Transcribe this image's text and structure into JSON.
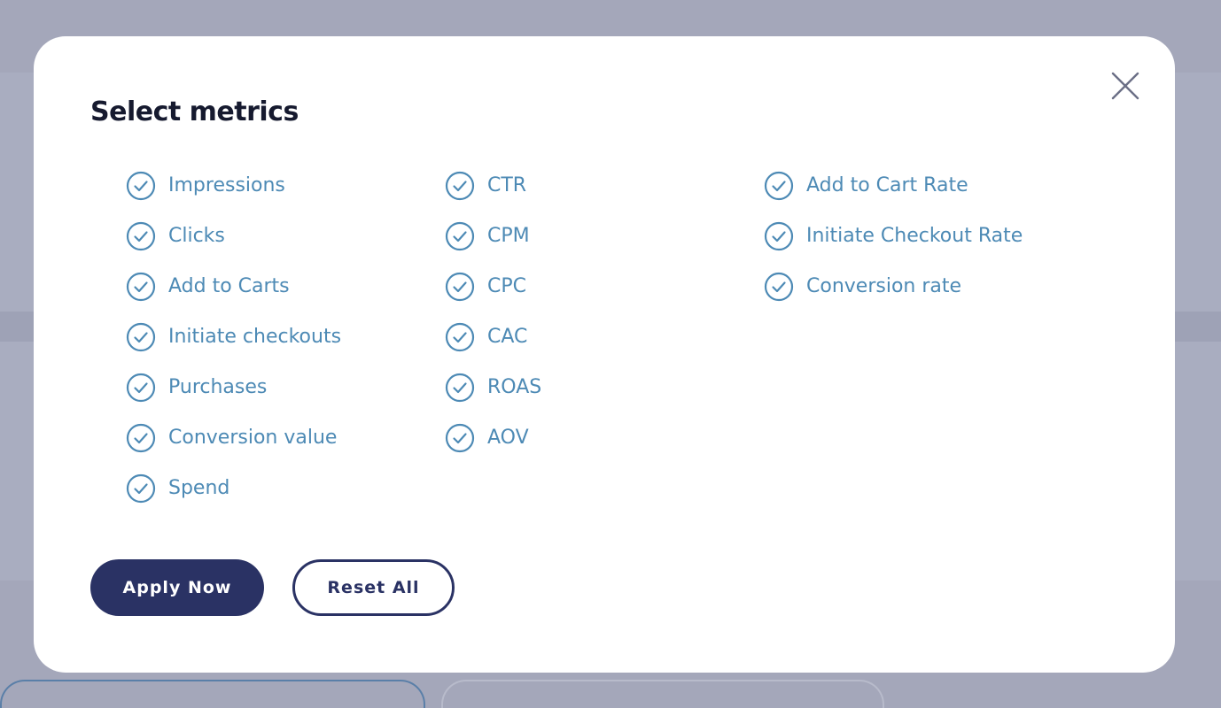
{
  "modal": {
    "title": "Select metrics"
  },
  "metrics": {
    "column1": [
      "Impressions",
      "Clicks",
      "Add to Carts",
      "Initiate checkouts",
      "Purchases",
      "Conversion value",
      "Spend"
    ],
    "column2": [
      "CTR",
      "CPM",
      "CPC",
      "CAC",
      "ROAS",
      "AOV"
    ],
    "column3": [
      "Add to Cart Rate",
      "Initiate Checkout Rate",
      "Conversion rate"
    ]
  },
  "buttons": {
    "apply_label": "Apply Now",
    "reset_label": "Reset All"
  },
  "colors": {
    "accent": "#2a3264",
    "metric_text": "#4d8ab5",
    "title_text": "#161a2f",
    "backdrop": "#a4a7ba"
  },
  "icons": {
    "close": "close-icon",
    "check": "check-circle-icon"
  }
}
